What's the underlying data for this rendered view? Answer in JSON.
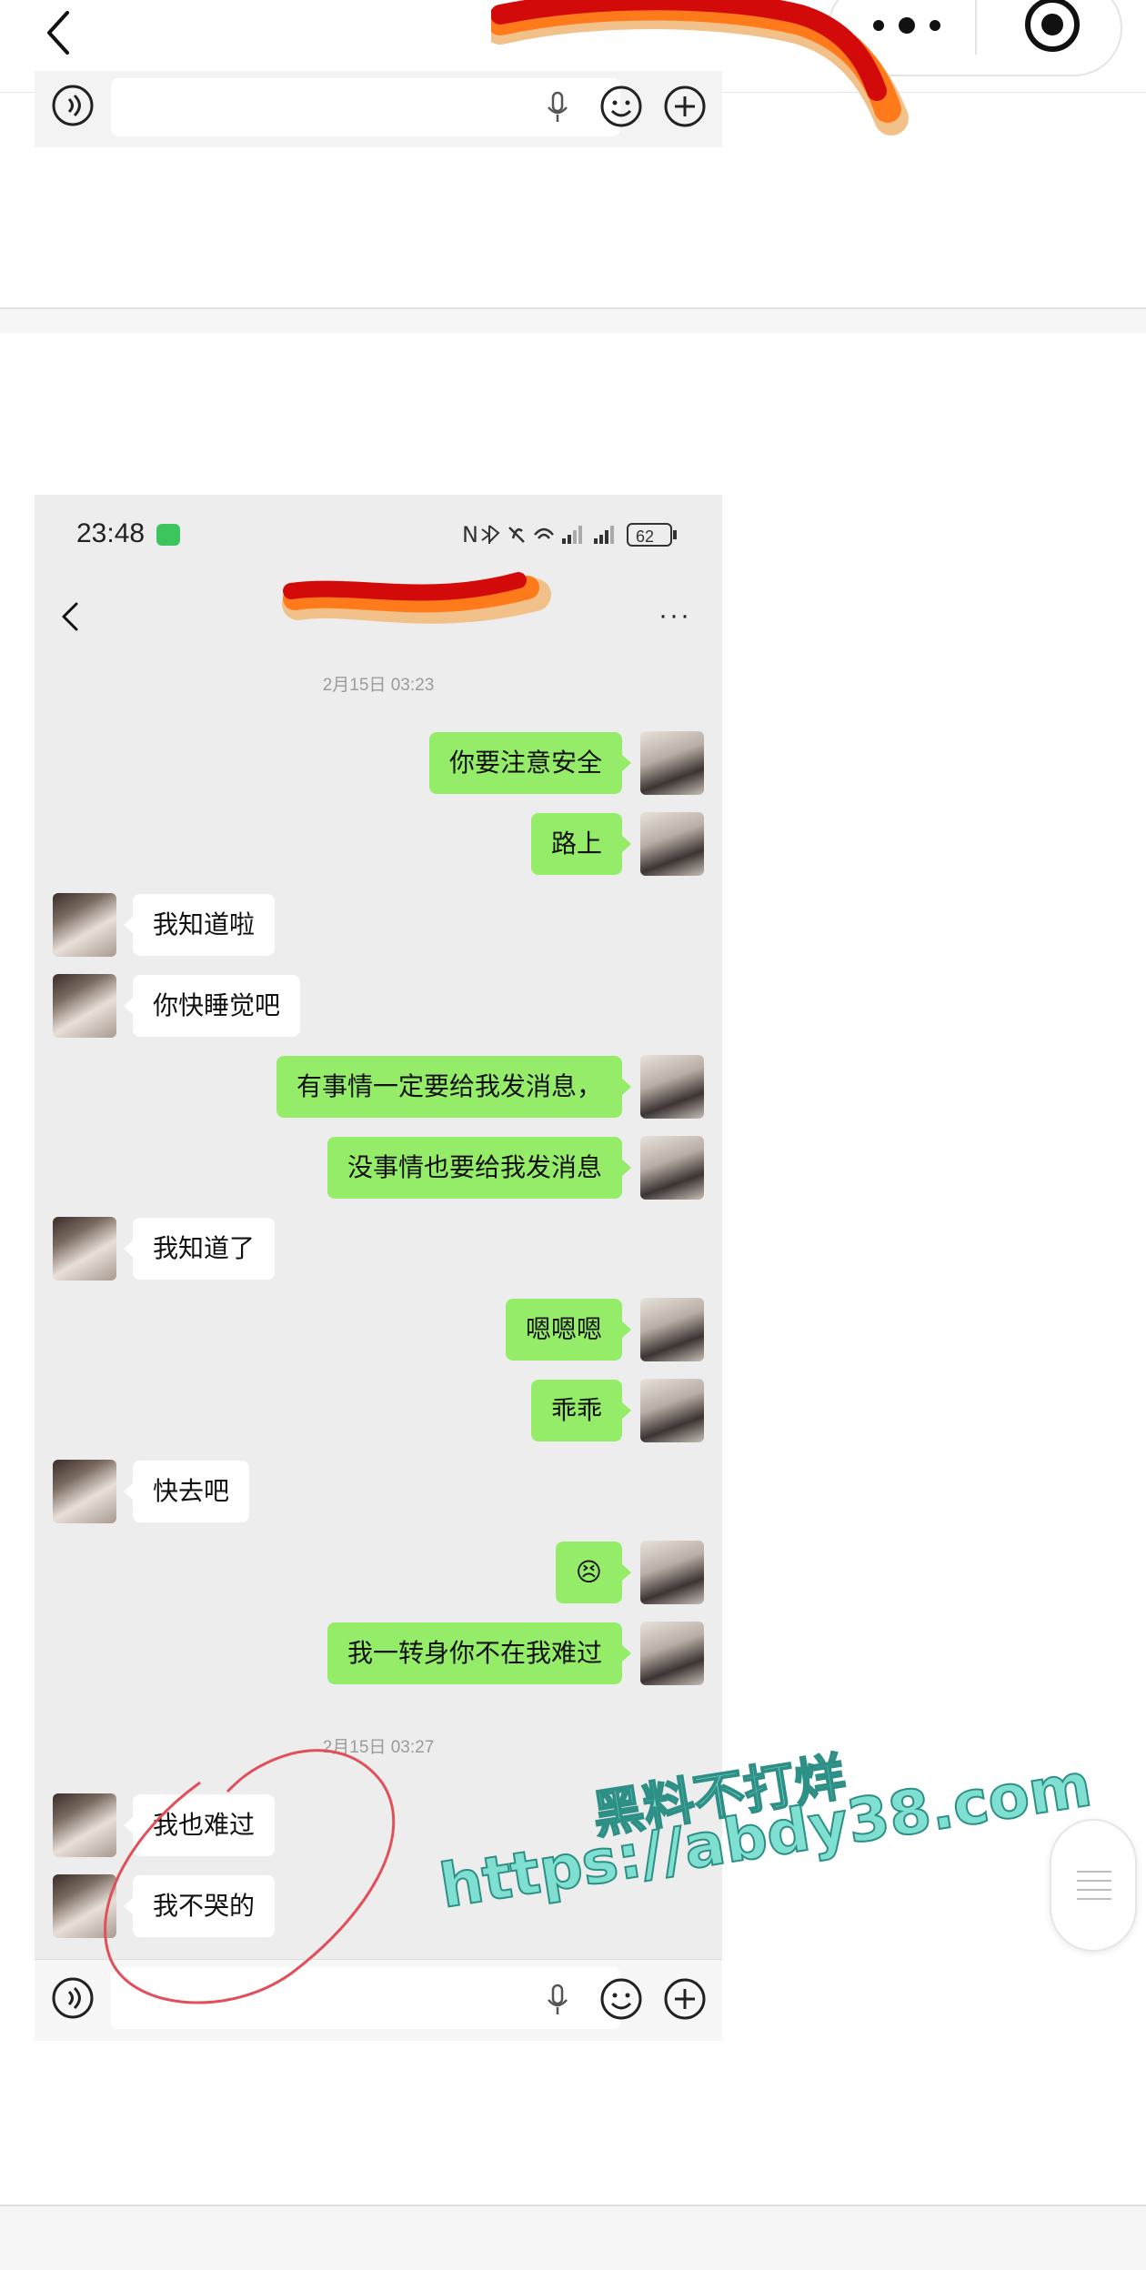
{
  "status": {
    "time": "23:48",
    "battery": "62"
  },
  "chat": {
    "more_label": "···",
    "timestamps": [
      "2月15日 03:23",
      "2月15日 03:27"
    ],
    "messages": [
      {
        "side": "me",
        "text": "你要注意安全"
      },
      {
        "side": "me",
        "text": "路上"
      },
      {
        "side": "them",
        "text": "我知道啦"
      },
      {
        "side": "them",
        "text": "你快睡觉吧"
      },
      {
        "side": "me",
        "text": "有事情一定要给我发消息，"
      },
      {
        "side": "me",
        "text": "没事情也要给我发消息"
      },
      {
        "side": "them",
        "text": "我知道了"
      },
      {
        "side": "me",
        "text": "嗯嗯嗯"
      },
      {
        "side": "me",
        "text": "乖乖"
      },
      {
        "side": "them",
        "text": "快去吧"
      },
      {
        "side": "me",
        "text": "😣"
      },
      {
        "side": "me",
        "text": "我一转身你不在我难过"
      },
      {
        "side": "them",
        "text": "我也难过"
      },
      {
        "side": "them",
        "text": "我不哭的"
      }
    ]
  },
  "watermark": {
    "line1": "黑料不打烊",
    "line2": "https://abdy38.com"
  },
  "colors": {
    "me_bubble": "#95ec69",
    "them_bubble": "#ffffff",
    "chat_bg": "#ededed",
    "watermark": "#7fe0d1",
    "circle_annotation": "#e0505a"
  }
}
